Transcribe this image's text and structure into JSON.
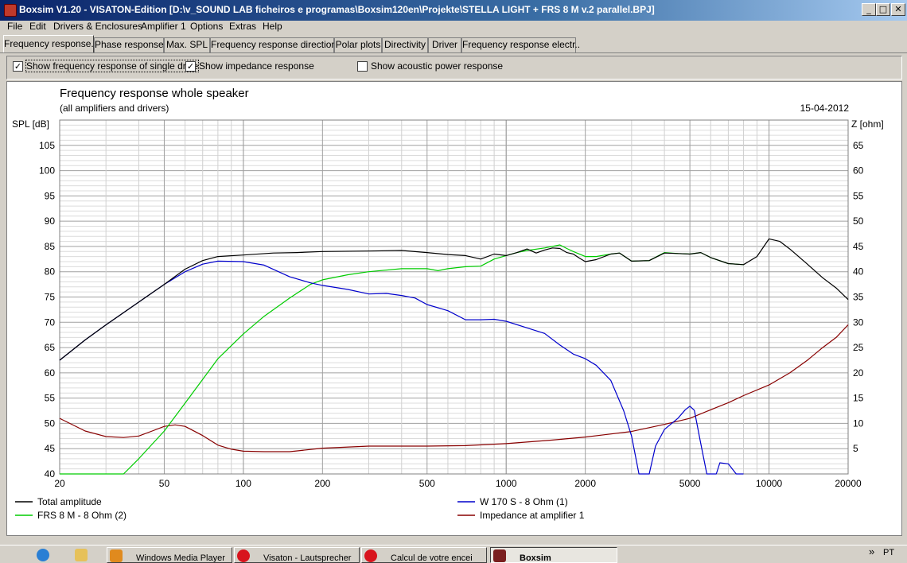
{
  "window": {
    "title": "Boxsim V1.20 - VISATON-Edition [D:\\v_SOUND LAB ficheiros e programas\\Boxsim120en\\Projekte\\STELLA LIGHT + FRS 8 M v.2 parallel.BPJ]",
    "minimize": "_",
    "maximize": "□",
    "close": "✕"
  },
  "menu": [
    "File",
    "Edit",
    "Drivers & Enclosures",
    "Amplifier 1",
    "Options",
    "Extras",
    "Help"
  ],
  "tabs": [
    "Frequency response.",
    "Phase response",
    "Max. SPL",
    "Frequency response directions",
    "Polar plots",
    "Directivity",
    "Driver",
    "Frequency response electr.."
  ],
  "options": {
    "single_driver": {
      "label": "Show frequency response of single drive",
      "checked": true,
      "mark": "✓"
    },
    "impedance": {
      "label": "Show impedance response",
      "checked": true,
      "mark": "✓"
    },
    "acoustic_power": {
      "label": "Show acoustic power response",
      "checked": false,
      "mark": ""
    }
  },
  "taskbar": {
    "items": [
      "Windows Media Player",
      "Visaton - Lautsprecher",
      "Calcul de votre encei",
      "Boxsim"
    ],
    "chevron": "»",
    "lang": "PT"
  },
  "chart_data": {
    "type": "line",
    "title": "Frequency response whole speaker",
    "subtitle": "(all amplifiers and drivers)",
    "date": "15-04-2012",
    "ylabel": "SPL [dB]",
    "y2label": "Z [ohm]",
    "x_scale": "log",
    "xlim": [
      20,
      20000
    ],
    "ylim": [
      40,
      110
    ],
    "y2lim": [
      0,
      70
    ],
    "x_ticks": [
      20,
      50,
      100,
      200,
      500,
      1000,
      2000,
      5000,
      10000,
      20000
    ],
    "y_ticks": [
      40,
      45,
      50,
      55,
      60,
      65,
      70,
      75,
      80,
      85,
      90,
      95,
      100,
      105
    ],
    "y2_ticks": [
      5,
      10,
      15,
      20,
      25,
      30,
      35,
      40,
      45,
      50,
      55,
      60,
      65
    ],
    "grid": true,
    "legend_position": "bottom",
    "series": [
      {
        "name": "Total amplitude",
        "color": "#000000",
        "axis": "left",
        "points": [
          [
            20,
            62.5
          ],
          [
            25,
            66.5
          ],
          [
            30,
            69.5
          ],
          [
            40,
            74
          ],
          [
            50,
            77.5
          ],
          [
            60,
            80.5
          ],
          [
            70,
            82.2
          ],
          [
            80,
            83
          ],
          [
            100,
            83.3
          ],
          [
            130,
            83.7
          ],
          [
            160,
            83.8
          ],
          [
            200,
            84
          ],
          [
            300,
            84.1
          ],
          [
            400,
            84.2
          ],
          [
            500,
            83.8
          ],
          [
            600,
            83.4
          ],
          [
            700,
            83.2
          ],
          [
            800,
            82.5
          ],
          [
            900,
            83.5
          ],
          [
            1000,
            83.2
          ],
          [
            1100,
            83.8
          ],
          [
            1200,
            84.5
          ],
          [
            1300,
            83.7
          ],
          [
            1400,
            84.3
          ],
          [
            1500,
            84.7
          ],
          [
            1600,
            84.6
          ],
          [
            1700,
            83.8
          ],
          [
            1800,
            83.5
          ],
          [
            1900,
            82.7
          ],
          [
            2000,
            82
          ],
          [
            2200,
            82.4
          ],
          [
            2500,
            83.5
          ],
          [
            2700,
            83.7
          ],
          [
            3000,
            82.1
          ],
          [
            3500,
            82.2
          ],
          [
            4000,
            83.7
          ],
          [
            4500,
            83.6
          ],
          [
            5000,
            83.5
          ],
          [
            5500,
            83.8
          ],
          [
            6000,
            82.8
          ],
          [
            7000,
            81.6
          ],
          [
            8000,
            81.4
          ],
          [
            9000,
            83
          ],
          [
            10000,
            86.5
          ],
          [
            11000,
            86
          ],
          [
            12000,
            84.5
          ],
          [
            14000,
            81.5
          ],
          [
            16000,
            78.8
          ],
          [
            18000,
            76.8
          ],
          [
            20000,
            74.5
          ]
        ]
      },
      {
        "name": "W 170 S - 8 Ohm (1)",
        "color": "#0000cc",
        "axis": "left",
        "points": [
          [
            20,
            62.5
          ],
          [
            25,
            66.5
          ],
          [
            30,
            69.5
          ],
          [
            40,
            74
          ],
          [
            50,
            77.5
          ],
          [
            60,
            80
          ],
          [
            70,
            81.5
          ],
          [
            80,
            82.1
          ],
          [
            100,
            82
          ],
          [
            120,
            81.3
          ],
          [
            150,
            79
          ],
          [
            180,
            77.8
          ],
          [
            200,
            77.3
          ],
          [
            250,
            76.5
          ],
          [
            300,
            75.6
          ],
          [
            350,
            75.7
          ],
          [
            400,
            75.3
          ],
          [
            450,
            74.8
          ],
          [
            500,
            73.5
          ],
          [
            600,
            72.3
          ],
          [
            700,
            70.5
          ],
          [
            800,
            70.5
          ],
          [
            900,
            70.6
          ],
          [
            1000,
            70.2
          ],
          [
            1200,
            68.9
          ],
          [
            1400,
            67.8
          ],
          [
            1600,
            65.5
          ],
          [
            1800,
            63.7
          ],
          [
            2000,
            62.8
          ],
          [
            2200,
            61.5
          ],
          [
            2500,
            58.5
          ],
          [
            2800,
            52.5
          ],
          [
            3000,
            47.5
          ],
          [
            3200,
            40
          ],
          [
            3500,
            40
          ],
          [
            3700,
            45.5
          ],
          [
            4000,
            48.8
          ],
          [
            4500,
            51
          ],
          [
            4800,
            52.7
          ],
          [
            5000,
            53.4
          ],
          [
            5200,
            52.6
          ],
          [
            5500,
            46
          ],
          [
            5800,
            40
          ],
          [
            6300,
            40
          ],
          [
            6500,
            42.2
          ],
          [
            7000,
            42
          ],
          [
            7500,
            40
          ],
          [
            8000,
            40
          ]
        ]
      },
      {
        "name": "FRS 8 M - 8 Ohm (2)",
        "color": "#00cc00",
        "axis": "left",
        "points": [
          [
            20,
            40
          ],
          [
            35,
            40
          ],
          [
            40,
            43
          ],
          [
            50,
            48.5
          ],
          [
            60,
            54
          ],
          [
            70,
            58.7
          ],
          [
            80,
            62.8
          ],
          [
            100,
            67.7
          ],
          [
            120,
            71.2
          ],
          [
            150,
            74.8
          ],
          [
            180,
            77.5
          ],
          [
            200,
            78.4
          ],
          [
            250,
            79.4
          ],
          [
            300,
            80
          ],
          [
            400,
            80.6
          ],
          [
            500,
            80.6
          ],
          [
            550,
            80.2
          ],
          [
            600,
            80.6
          ],
          [
            700,
            81
          ],
          [
            800,
            81.1
          ],
          [
            900,
            82.5
          ],
          [
            1000,
            83.2
          ],
          [
            1100,
            83.8
          ],
          [
            1200,
            84.2
          ],
          [
            1400,
            84.7
          ],
          [
            1600,
            85.3
          ],
          [
            1700,
            84.6
          ],
          [
            1800,
            84
          ],
          [
            2000,
            83
          ],
          [
            2200,
            83
          ],
          [
            2500,
            83.5
          ],
          [
            2700,
            83.7
          ],
          [
            3000,
            82.1
          ],
          [
            3500,
            82.2
          ],
          [
            4000,
            83.8
          ],
          [
            4500,
            83.6
          ],
          [
            5000,
            83.5
          ],
          [
            5500,
            83.8
          ],
          [
            6000,
            82.8
          ],
          [
            7000,
            81.6
          ],
          [
            8000,
            81.4
          ]
        ]
      },
      {
        "name": "Impedance at amplifier 1",
        "color": "#880000",
        "axis": "right",
        "points": [
          [
            20,
            11
          ],
          [
            25,
            8.5
          ],
          [
            30,
            7.4
          ],
          [
            35,
            7.2
          ],
          [
            40,
            7.5
          ],
          [
            45,
            8.5
          ],
          [
            50,
            9.4
          ],
          [
            55,
            9.7
          ],
          [
            60,
            9.4
          ],
          [
            70,
            7.6
          ],
          [
            80,
            5.7
          ],
          [
            90,
            4.9
          ],
          [
            100,
            4.5
          ],
          [
            120,
            4.4
          ],
          [
            150,
            4.4
          ],
          [
            200,
            5.1
          ],
          [
            300,
            5.5
          ],
          [
            500,
            5.5
          ],
          [
            700,
            5.6
          ],
          [
            1000,
            6
          ],
          [
            1500,
            6.7
          ],
          [
            2000,
            7.3
          ],
          [
            3000,
            8.4
          ],
          [
            4000,
            9.8
          ],
          [
            5000,
            11
          ],
          [
            6000,
            12.7
          ],
          [
            7000,
            14.1
          ],
          [
            8000,
            15.5
          ],
          [
            10000,
            17.6
          ],
          [
            12000,
            20
          ],
          [
            14000,
            22.5
          ],
          [
            16000,
            25
          ],
          [
            18000,
            27
          ],
          [
            20000,
            29.5
          ]
        ]
      }
    ]
  }
}
